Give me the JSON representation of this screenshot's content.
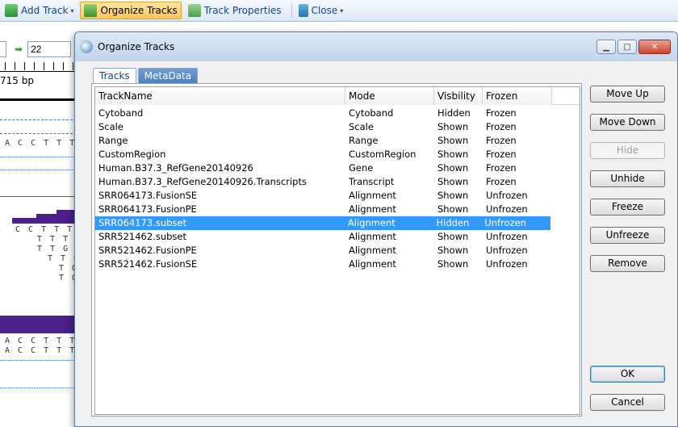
{
  "toolbar": {
    "add_track": "Add Track",
    "organize_tracks": "Organize Tracks",
    "track_properties": "Track Properties",
    "close": "Close",
    "caret": "▾"
  },
  "nav": {
    "go_arrow": "➡",
    "position_value": "22"
  },
  "background": {
    "bp_label": "715 bp",
    "seq_rows": [
      "A C C T T T G",
      "C C T T T G",
      "T T T G",
      "T T G",
      "T T G",
      "T G",
      "T G",
      "A C C T T T G",
      "A C C T T T G"
    ]
  },
  "dialog": {
    "title": "Organize Tracks",
    "win_minimize": "▁",
    "win_maximize": "□",
    "win_close": "✕",
    "tabs": [
      {
        "label": "Tracks"
      },
      {
        "label": "MetaData"
      }
    ],
    "columns": [
      "TrackName",
      "Mode",
      "Visbility",
      "Frozen"
    ],
    "rows": [
      [
        "Cytoband",
        "Cytoband",
        "Hidden",
        "Frozen"
      ],
      [
        "Scale",
        "Scale",
        "Shown",
        "Frozen"
      ],
      [
        "Range",
        "Range",
        "Shown",
        "Frozen"
      ],
      [
        "CustomRegion",
        "CustomRegion",
        "Shown",
        "Frozen"
      ],
      [
        "Human.B37.3_RefGene20140926",
        "Gene",
        "Shown",
        "Frozen"
      ],
      [
        "Human.B37.3_RefGene20140926.Transcripts",
        "Transcript",
        "Shown",
        "Frozen"
      ],
      [
        "SRR064173.FusionSE",
        "Alignment",
        "Shown",
        "Unfrozen"
      ],
      [
        "SRR064173.FusionPE",
        "Alignment",
        "Shown",
        "Unfrozen"
      ],
      [
        "SRR064173.subset",
        "Alignment",
        "Hidden",
        "Unfrozen"
      ],
      [
        "SRR521462.subset",
        "Alignment",
        "Shown",
        "Unfrozen"
      ],
      [
        "SRR521462.FusionPE",
        "Alignment",
        "Shown",
        "Unfrozen"
      ],
      [
        "SRR521462.FusionSE",
        "Alignment",
        "Shown",
        "Unfrozen"
      ]
    ],
    "buttons": {
      "move_up": "Move Up",
      "move_down": "Move Down",
      "hide": "Hide",
      "unhide": "Unhide",
      "freeze": "Freeze",
      "unfreeze": "Unfreeze",
      "remove": "Remove",
      "ok": "OK",
      "cancel": "Cancel"
    }
  },
  "colors": {
    "selection": "#3399ff",
    "accent": "#15428b",
    "read_fill": "#4b1f8c"
  }
}
